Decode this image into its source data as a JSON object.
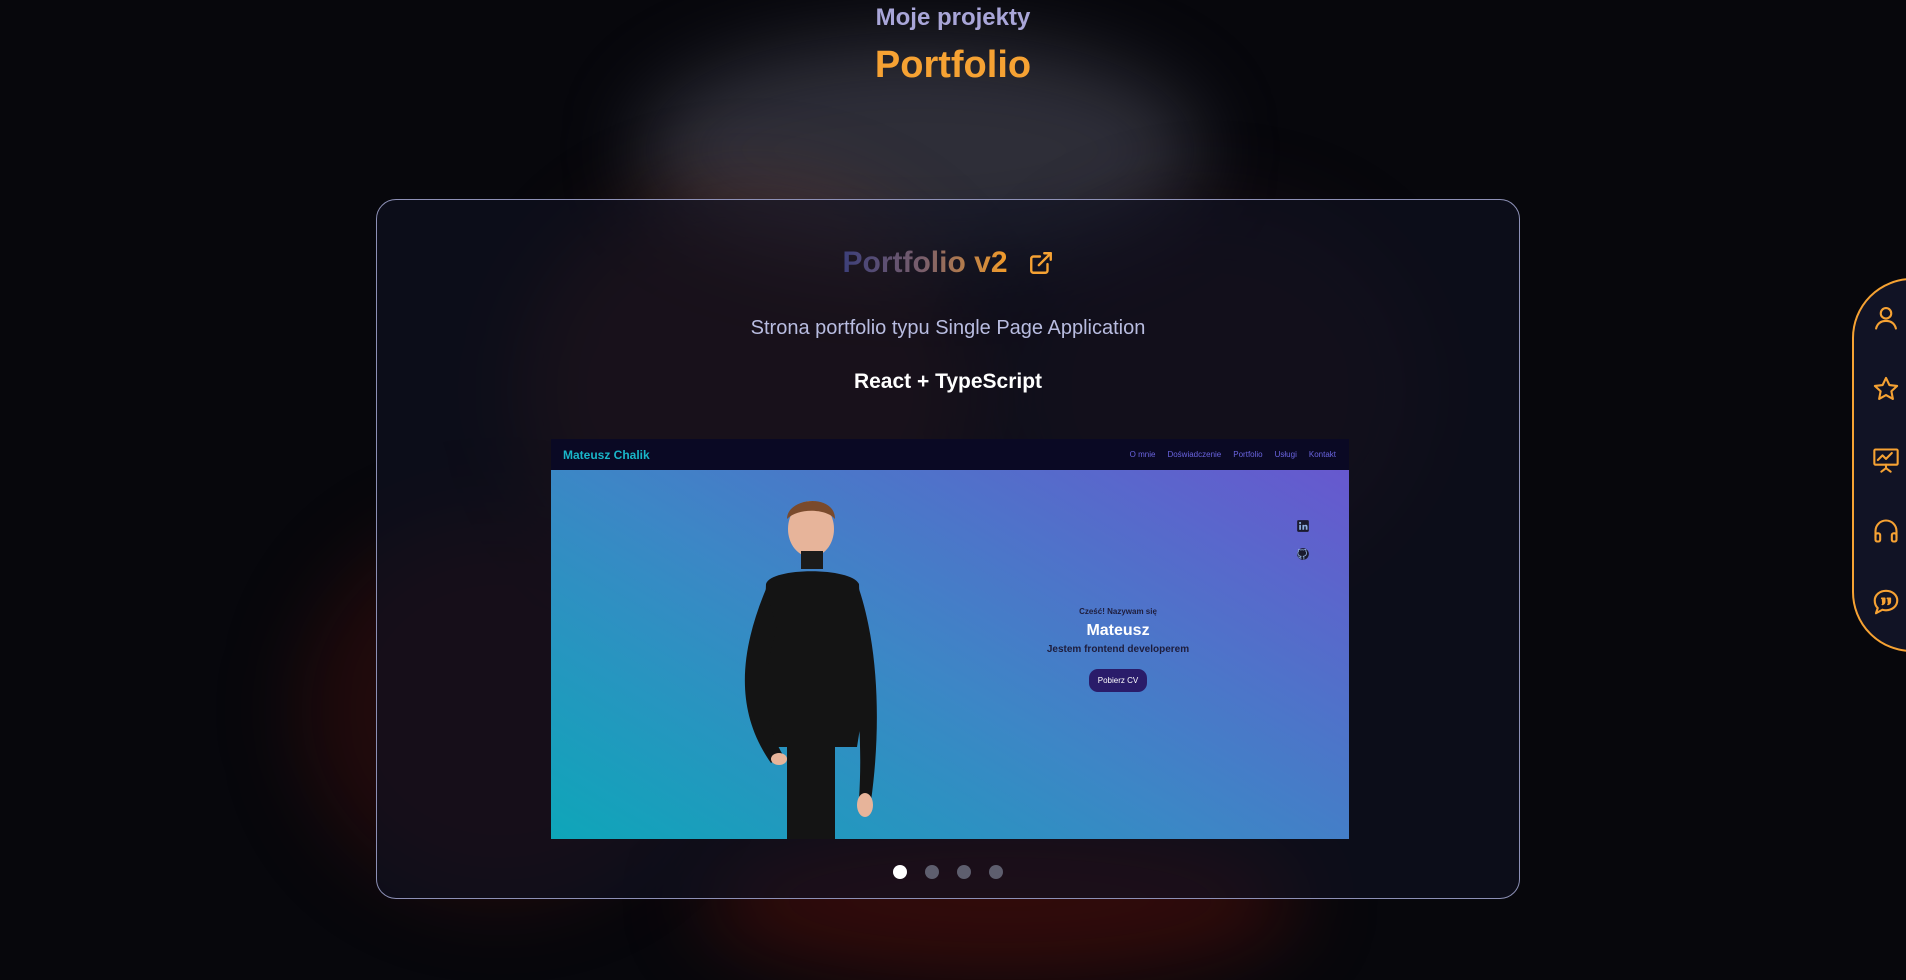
{
  "section": {
    "subtitle": "Moje projekty",
    "title": "Portfolio"
  },
  "project": {
    "title": "Portfolio v2",
    "external_link_icon": "external-link-icon",
    "description": "Strona portfolio typu Single Page Application",
    "tech": "React + TypeScript",
    "preview": {
      "brand": "Mateusz Chalik",
      "menu": [
        "O mnie",
        "Doświadczenie",
        "Portfolio",
        "Usługi",
        "Kontakt"
      ],
      "social_icons": [
        "linkedin-icon",
        "github-icon"
      ],
      "greeting": "Cześć! Nazywam się",
      "name": "Mateusz",
      "role": "Jestem frontend developerem",
      "cta": "Pobierz CV"
    }
  },
  "carousel": {
    "total": 4,
    "active_index": 0
  },
  "side_nav": {
    "icons": [
      "user-icon",
      "star-icon",
      "presentation-chart-icon",
      "headphones-icon",
      "chat-quote-icon"
    ]
  },
  "colors": {
    "accent": "#f6a233",
    "subtitle": "#a9a6d8",
    "background": "#07070c",
    "card_border": "#8d90b6"
  }
}
